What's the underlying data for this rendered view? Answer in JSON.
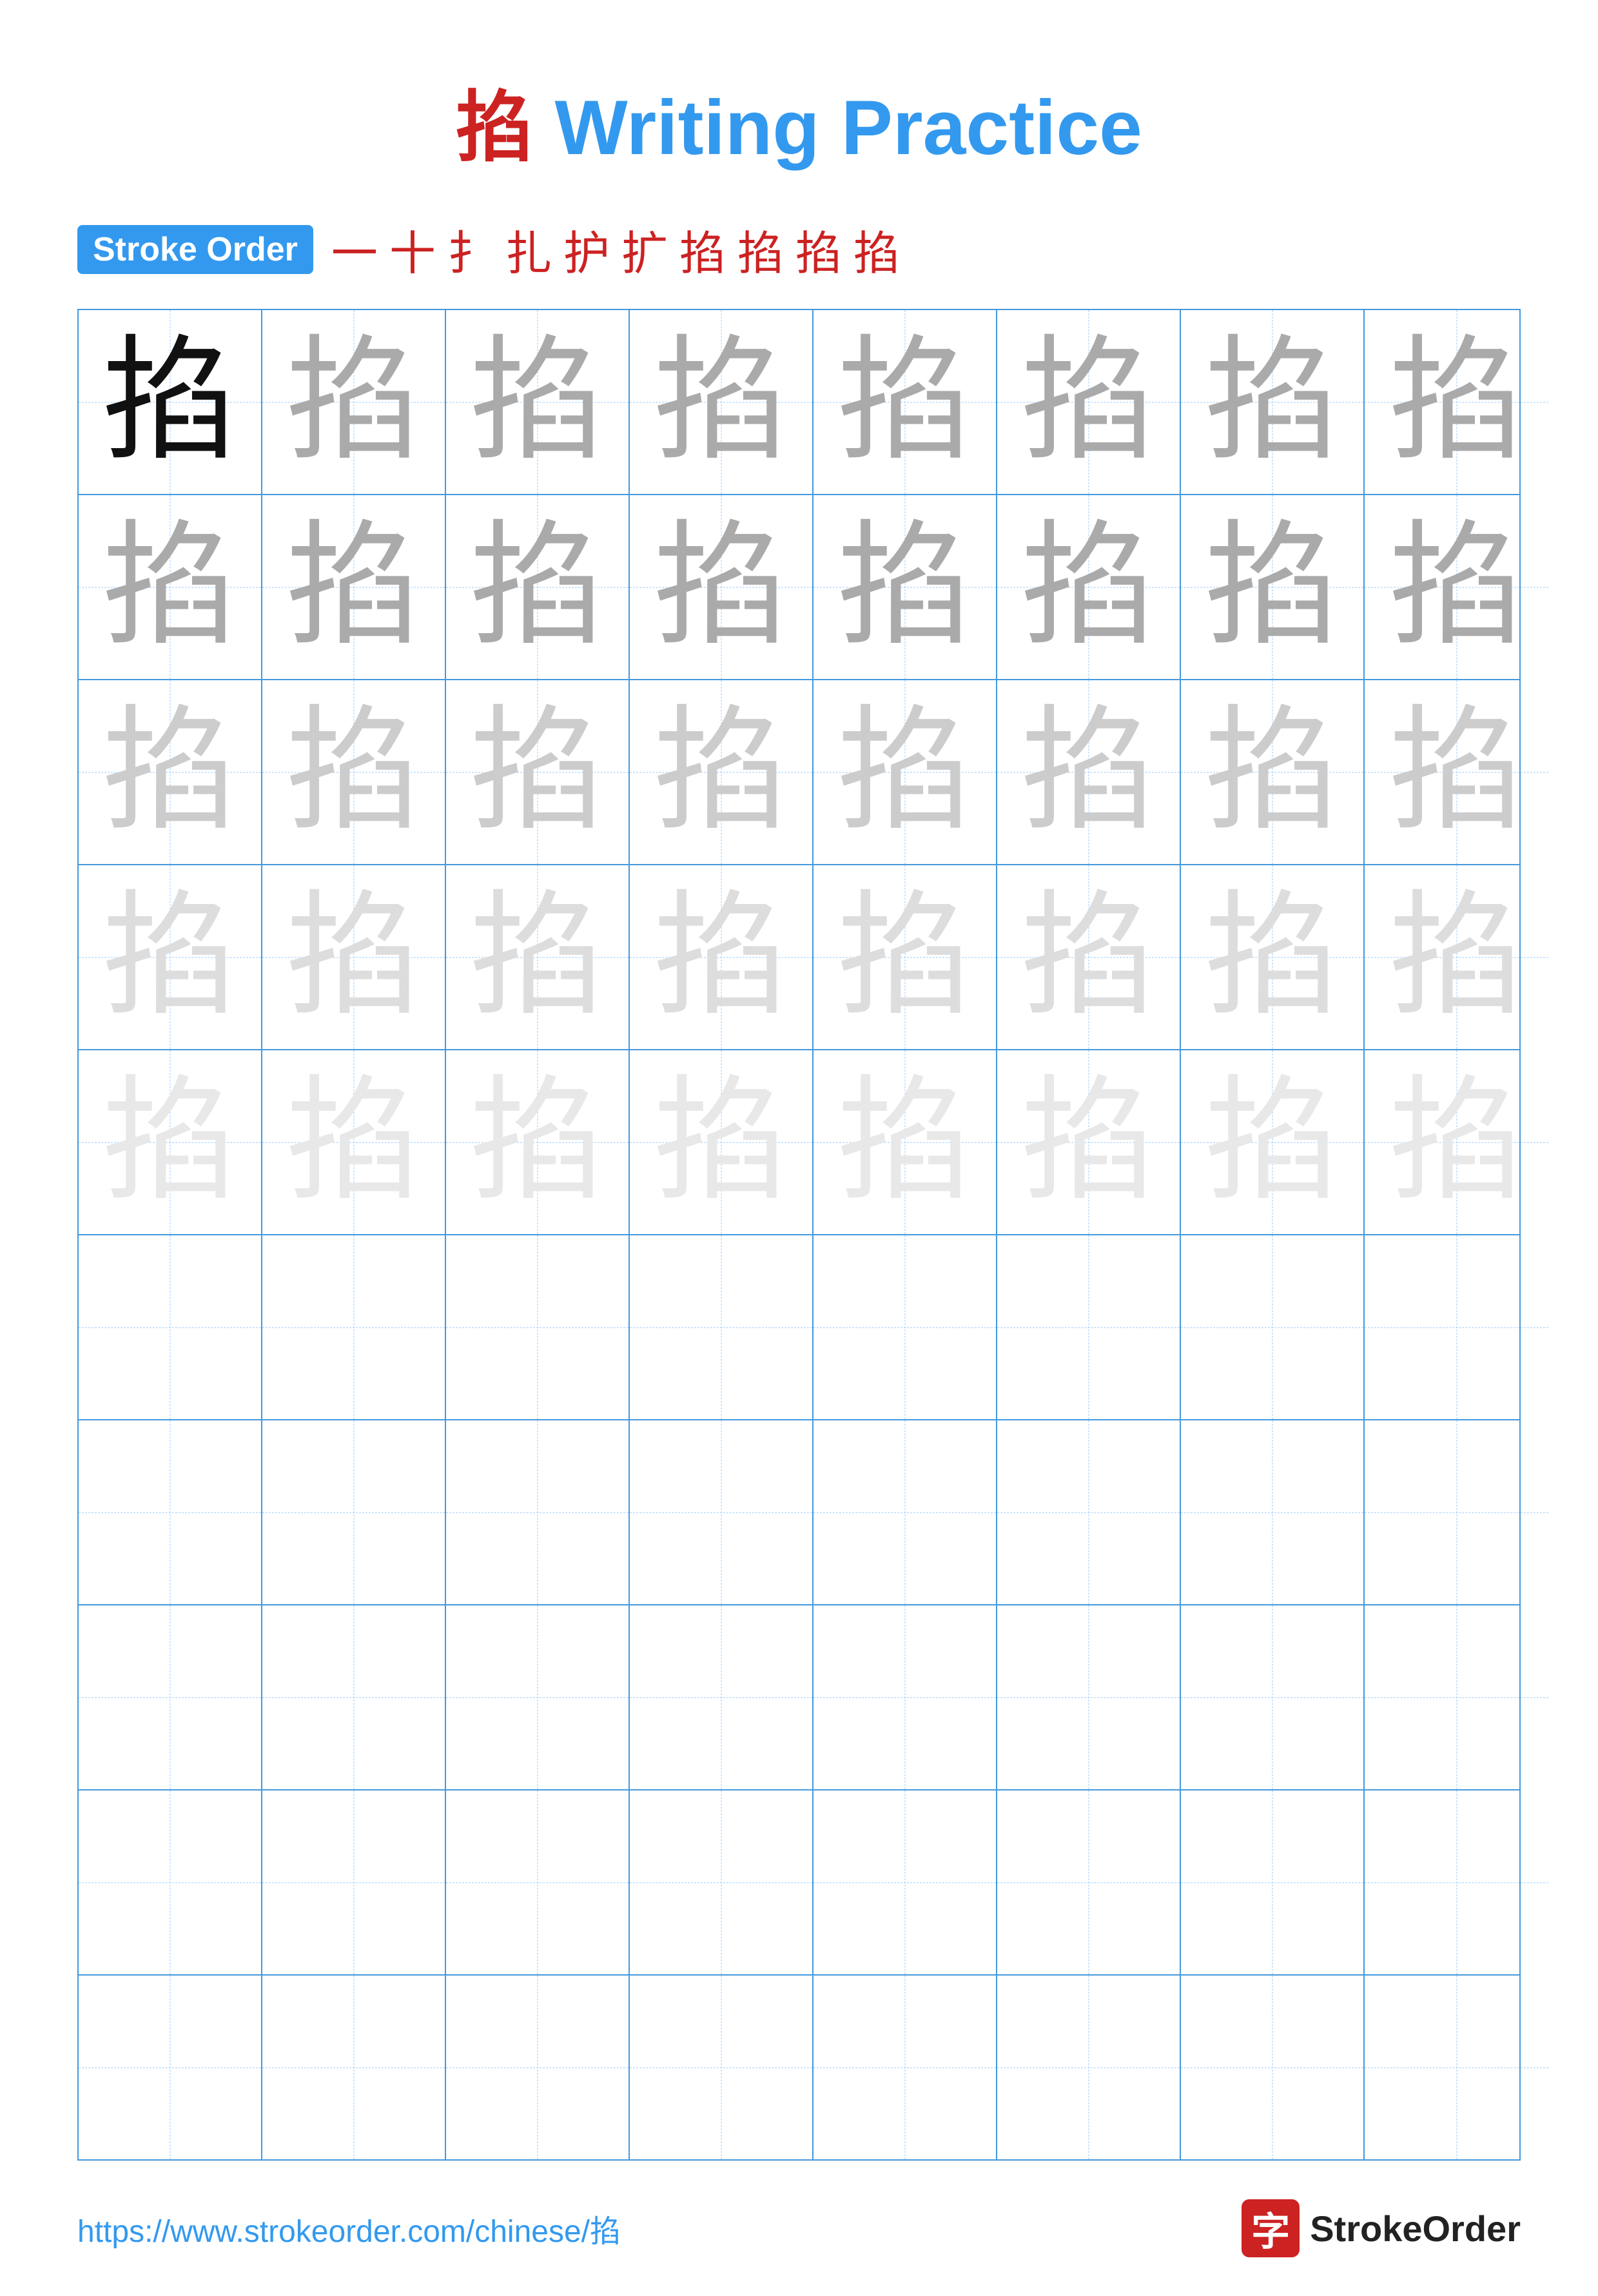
{
  "title": {
    "char": "掐",
    "suffix": " Writing Practice"
  },
  "stroke_order": {
    "badge_label": "Stroke Order",
    "steps": [
      "一",
      "十",
      "扌",
      "扎",
      "护",
      "扩",
      "掐",
      "掐",
      "掐",
      "掐"
    ]
  },
  "grid": {
    "cols": 8,
    "rows": [
      {
        "chars": [
          "掐",
          "掐",
          "掐",
          "掐",
          "掐",
          "掐",
          "掐",
          "掐"
        ],
        "shade": "row1"
      },
      {
        "chars": [
          "掐",
          "掐",
          "掐",
          "掐",
          "掐",
          "掐",
          "掐",
          "掐"
        ],
        "shade": "row2"
      },
      {
        "chars": [
          "掐",
          "掐",
          "掐",
          "掐",
          "掐",
          "掐",
          "掐",
          "掐"
        ],
        "shade": "row3"
      },
      {
        "chars": [
          "掐",
          "掐",
          "掐",
          "掐",
          "掐",
          "掐",
          "掐",
          "掐"
        ],
        "shade": "row4"
      },
      {
        "chars": [
          "掐",
          "掐",
          "掐",
          "掐",
          "掐",
          "掐",
          "掐",
          "掐"
        ],
        "shade": "row5"
      },
      {
        "chars": [],
        "shade": "empty"
      },
      {
        "chars": [],
        "shade": "empty"
      },
      {
        "chars": [],
        "shade": "empty"
      },
      {
        "chars": [],
        "shade": "empty"
      },
      {
        "chars": [],
        "shade": "empty"
      }
    ]
  },
  "footer": {
    "url": "https://www.strokeorder.com/chinese/掐",
    "logo_char": "字",
    "logo_text": "StrokeOrder"
  }
}
